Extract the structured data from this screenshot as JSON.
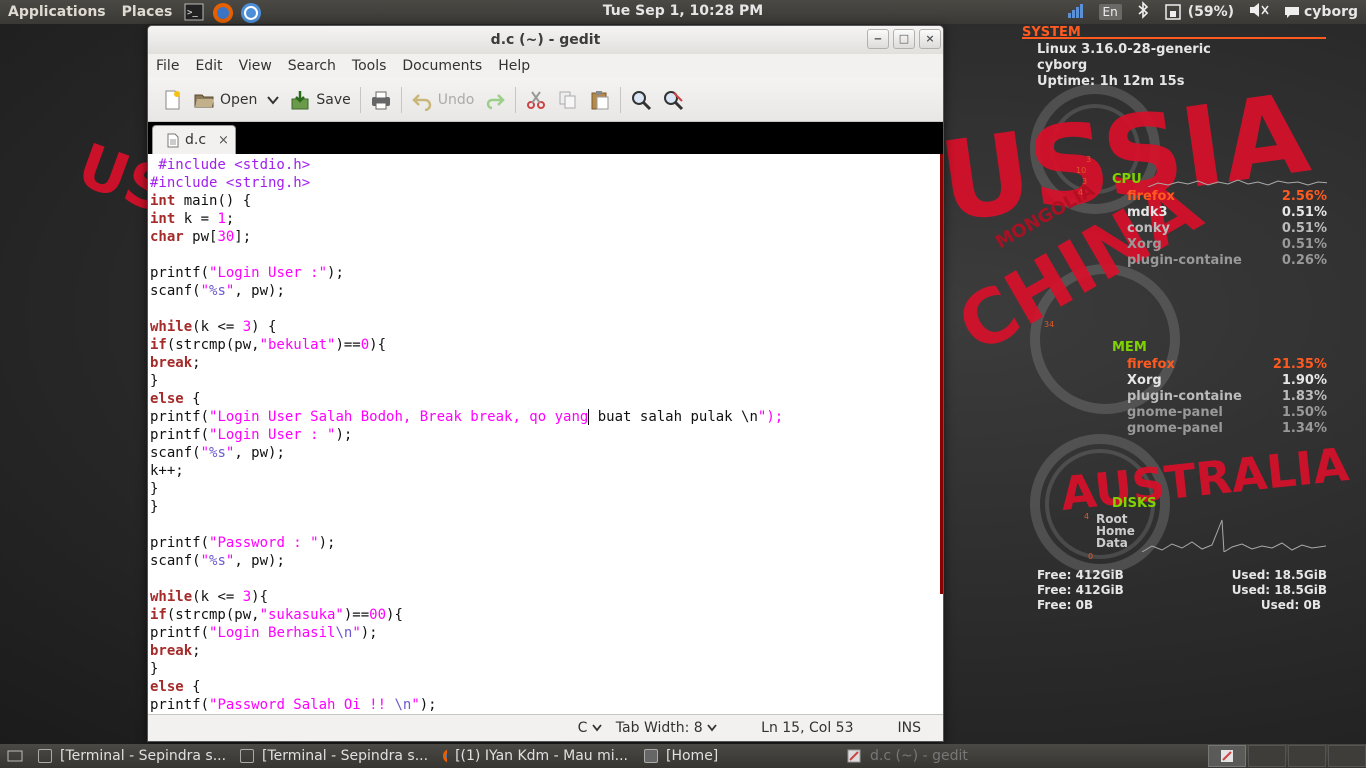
{
  "top_panel": {
    "applications": "Applications",
    "places": "Places",
    "clock": "Tue Sep  1, 10:28 PM",
    "keyboard": "En",
    "battery": "(59%)",
    "user": "cyborg"
  },
  "window": {
    "title": "d.c (~) - gedit",
    "minimize": "‒",
    "maximize": "□",
    "close": "×"
  },
  "menubar": [
    "File",
    "Edit",
    "View",
    "Search",
    "Tools",
    "Documents",
    "Help"
  ],
  "toolbar": {
    "open_label": "Open",
    "save_label": "Save",
    "undo_label": "Undo"
  },
  "tab": {
    "label": "d.c",
    "close": "×"
  },
  "editor": {
    "lines": [
      " #include <stdio.h>",
      "#include <string.h>",
      "int main() {",
      "int k = 1;",
      "char pw[30];",
      "",
      "printf(\"Login User :\");",
      "scanf(\"%s\", pw);",
      "",
      "while(k <= 3) {",
      "if(strcmp(pw,\"bekulat\")==0){",
      "break;",
      "}",
      "else {",
      "printf(\"Login User Salah Bodoh, Break break, qo yang buat salah pulak \\n\");",
      "printf(\"Login User : \");",
      "scanf(\"%s\", pw);",
      "k++;",
      "}",
      "}",
      "",
      "printf(\"Password : \");",
      "scanf(\"%s\", pw);",
      "",
      "while(k <= 3){",
      "if(strcmp(pw,\"sukasuka\")==00){",
      "printf(\"Login Berhasil\\n\");",
      "break;",
      "}",
      "else {",
      "printf(\"Password Salah Oi !! \\n\");"
    ]
  },
  "statusbar": {
    "language": "C",
    "tab_width": "Tab Width: 8",
    "position": "Ln 15, Col 53",
    "mode": "INS"
  },
  "conky": {
    "system_header": "SYSTEM",
    "kernel": "Linux 3.16.0-28-generic",
    "hostname": "cyborg",
    "uptime": "Uptime: 1h 12m 15s",
    "cpu_header": "CPU",
    "cpu_procs": [
      {
        "name": "firefox",
        "value": "2.56%"
      },
      {
        "name": "mdk3",
        "value": "0.51%"
      },
      {
        "name": "conky",
        "value": "0.51%"
      },
      {
        "name": "Xorg",
        "value": "0.51%"
      },
      {
        "name": "plugin-containe",
        "value": "0.26%"
      }
    ],
    "mem_header": "MEM",
    "mem_procs": [
      {
        "name": "firefox",
        "value": "21.35%"
      },
      {
        "name": "Xorg",
        "value": "1.90%"
      },
      {
        "name": "plugin-containe",
        "value": "1.83%"
      },
      {
        "name": "gnome-panel",
        "value": "1.50%"
      },
      {
        "name": "gnome-panel",
        "value": "1.34%"
      }
    ],
    "disks_header": "DISKS",
    "disk_labels": [
      "Root",
      "Home",
      "Data"
    ],
    "disk_free": [
      "Free: 412GiB",
      "Free: 412GiB",
      "Free: 0B"
    ],
    "disk_used": [
      "Used: 18.5GiB",
      "Used: 18.5GiB",
      "Used: 0B"
    ],
    "ring_ticks_cpu": [
      "3",
      "10",
      "3",
      "4"
    ],
    "ring_ticks_mem": [
      "34"
    ],
    "ring_ticks_disk": [
      "4",
      "0"
    ]
  },
  "wallpaper_words": [
    "USSIA",
    "CHINA",
    "MONGOLIA",
    "AUSTRALIA",
    "US"
  ],
  "taskbar": [
    {
      "label": "[Terminal - Sepindra s..."
    },
    {
      "label": "[Terminal - Sepindra s..."
    },
    {
      "label": "[(1) IYan Kdm - Mau mi..."
    },
    {
      "label": "[Home]"
    },
    {
      "label": "d.c (~) - gedit"
    }
  ],
  "colors": {
    "keyword": "#a52a2a",
    "preprocessor": "#a020f0",
    "string": "#ff00ff",
    "conky_accent": "#ff5a1f",
    "conky_green": "#7fd400",
    "wallpaper_red": "#d8102a"
  }
}
